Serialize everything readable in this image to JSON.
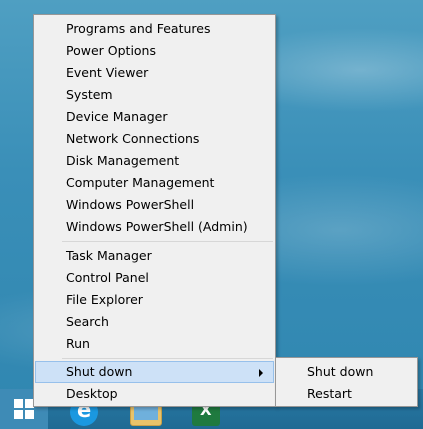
{
  "menu": {
    "group1": [
      "Programs and Features",
      "Power Options",
      "Event Viewer",
      "System",
      "Device Manager",
      "Network Connections",
      "Disk Management",
      "Computer Management",
      "Windows PowerShell",
      "Windows PowerShell (Admin)"
    ],
    "group2": [
      "Task Manager",
      "Control Panel",
      "File Explorer",
      "Search",
      "Run"
    ],
    "shutdown": "Shut down",
    "desktop": "Desktop"
  },
  "submenu": {
    "items": [
      "Shut down",
      "Restart"
    ]
  },
  "taskbar": {
    "icons": [
      "windows-logo-icon",
      "internet-explorer-icon",
      "file-explorer-icon",
      "excel-icon"
    ]
  },
  "colors": {
    "highlight": "#cde1f7",
    "menu_bg": "#f0f0f0",
    "desktop": "#3a8fb8"
  }
}
